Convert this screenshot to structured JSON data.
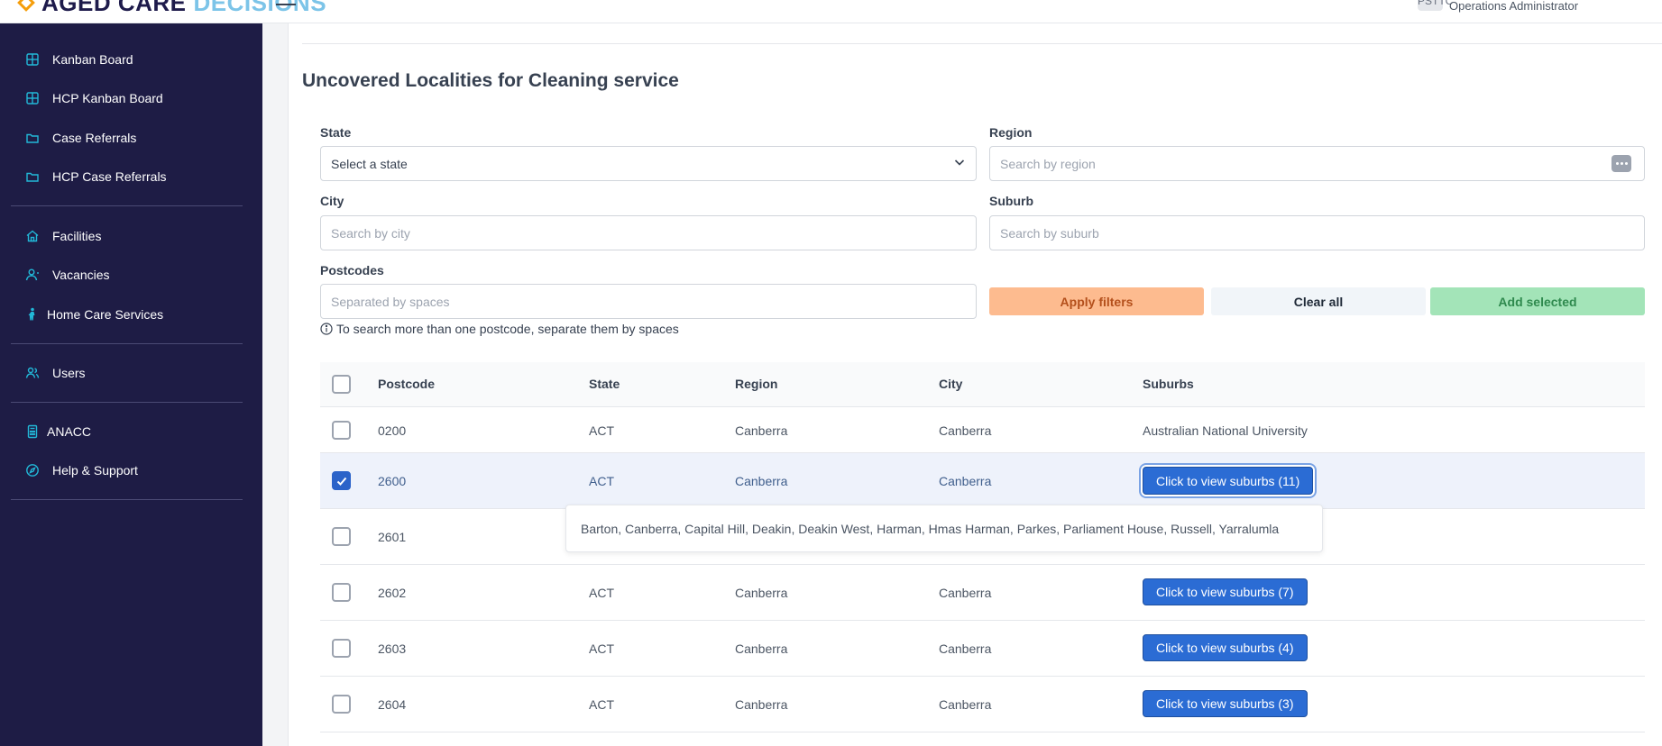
{
  "header": {
    "logo_part1": "AGED CARE",
    "logo_part2": "DECISIONS",
    "user_initials": "PSTTC",
    "user_role": "Operations Administrator"
  },
  "sidebar": {
    "items": [
      {
        "label": "Kanban Board",
        "icon": "grid-icon"
      },
      {
        "label": "HCP Kanban Board",
        "icon": "grid-icon"
      },
      {
        "label": "Case Referrals",
        "icon": "folder-icon"
      },
      {
        "label": "HCP Case Referrals",
        "icon": "folder-icon"
      },
      {
        "label": "Facilities",
        "icon": "home-icon"
      },
      {
        "label": "Vacancies",
        "icon": "user-icon"
      },
      {
        "label": "Home Care Services",
        "icon": "person-walking-icon"
      },
      {
        "label": "Users",
        "icon": "users-icon"
      },
      {
        "label": "ANACC",
        "icon": "calculator-icon"
      },
      {
        "label": "Help & Support",
        "icon": "compass-icon"
      }
    ],
    "colors": {
      "background": "#1e1c45",
      "icon": "#22b8d8"
    }
  },
  "page": {
    "title": "Uncovered Localities for Cleaning service"
  },
  "filters": {
    "state_label": "State",
    "state_value": "Select a state",
    "region_label": "Region",
    "region_placeholder": "Search by region",
    "city_label": "City",
    "city_placeholder": "Search by city",
    "suburb_label": "Suburb",
    "suburb_placeholder": "Search by suburb",
    "postcodes_label": "Postcodes",
    "postcodes_placeholder": "Separated by spaces",
    "hint": "To search more than one postcode, separate them by spaces",
    "apply_label": "Apply filters",
    "clear_label": "Clear all",
    "add_label": "Add selected"
  },
  "table": {
    "columns": [
      "Postcode",
      "State",
      "Region",
      "City",
      "Suburbs"
    ],
    "rows": [
      {
        "postcode": "0200",
        "state": "ACT",
        "region": "Canberra",
        "city": "Canberra",
        "suburbs": "Australian National University",
        "checked": false
      },
      {
        "postcode": "2600",
        "state": "ACT",
        "region": "Canberra",
        "city": "Canberra",
        "suburbs": "Click to view suburbs (11)",
        "checked": true
      },
      {
        "postcode": "2601",
        "state": "",
        "region": "",
        "city": "",
        "suburbs": "",
        "checked": false
      },
      {
        "postcode": "2602",
        "state": "ACT",
        "region": "Canberra",
        "city": "Canberra",
        "suburbs": "Click to view suburbs (7)",
        "checked": false
      },
      {
        "postcode": "2603",
        "state": "ACT",
        "region": "Canberra",
        "city": "Canberra",
        "suburbs": "Click to view suburbs (4)",
        "checked": false
      },
      {
        "postcode": "2604",
        "state": "ACT",
        "region": "Canberra",
        "city": "Canberra",
        "suburbs": "Click to view suburbs (3)",
        "checked": false
      }
    ],
    "popover_text": "Barton, Canberra, Capital Hill, Deakin, Deakin West, Harman, Hmas Harman, Parkes, Parliament House, Russell, Yarralumla"
  }
}
